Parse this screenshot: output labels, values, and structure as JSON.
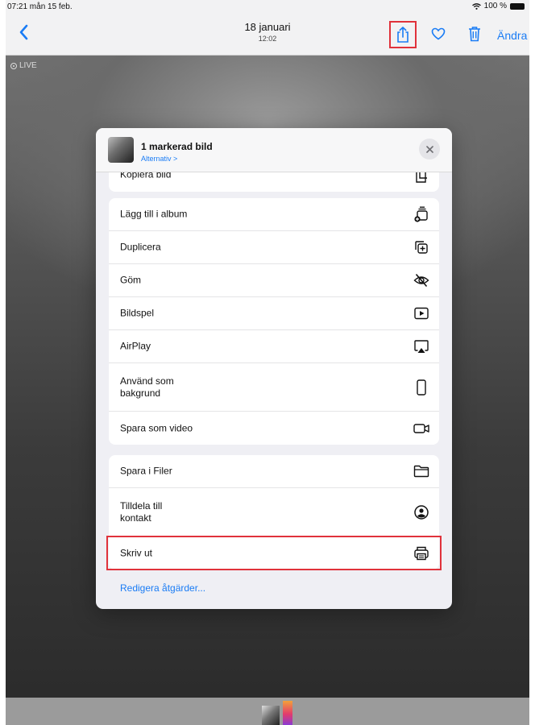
{
  "status": {
    "time": "07:21  mån 15 feb.",
    "battery": "100 %"
  },
  "nav": {
    "date": "18 januari",
    "time": "12:02",
    "edit_label": "Ändra"
  },
  "live_label": "LIVE",
  "sheet": {
    "title": "1 markerad bild",
    "subtitle": "Alternativ >",
    "top_item": {
      "label": "Kopiera bild",
      "icon": "copy-icon"
    },
    "group1": [
      {
        "label": "Lägg till i album",
        "icon": "add-to-album-icon"
      },
      {
        "label": "Duplicera",
        "icon": "duplicate-icon"
      },
      {
        "label": "Göm",
        "icon": "eye-slash-icon"
      },
      {
        "label": "Bildspel",
        "icon": "play-icon"
      },
      {
        "label": "AirPlay",
        "icon": "airplay-icon"
      },
      {
        "label": "Använd som\nbakgrund",
        "icon": "phone-icon"
      },
      {
        "label": "Spara som video",
        "icon": "video-icon"
      }
    ],
    "group2": [
      {
        "label": "Spara i Filer",
        "icon": "folder-icon"
      },
      {
        "label": "Tilldela till\nkontakt",
        "icon": "contact-icon"
      },
      {
        "label": "Skriv ut",
        "icon": "printer-icon"
      }
    ],
    "edit_actions": "Redigera åtgärder..."
  },
  "colors": {
    "accent": "#1a7cf5",
    "highlight": "#e0323b"
  }
}
